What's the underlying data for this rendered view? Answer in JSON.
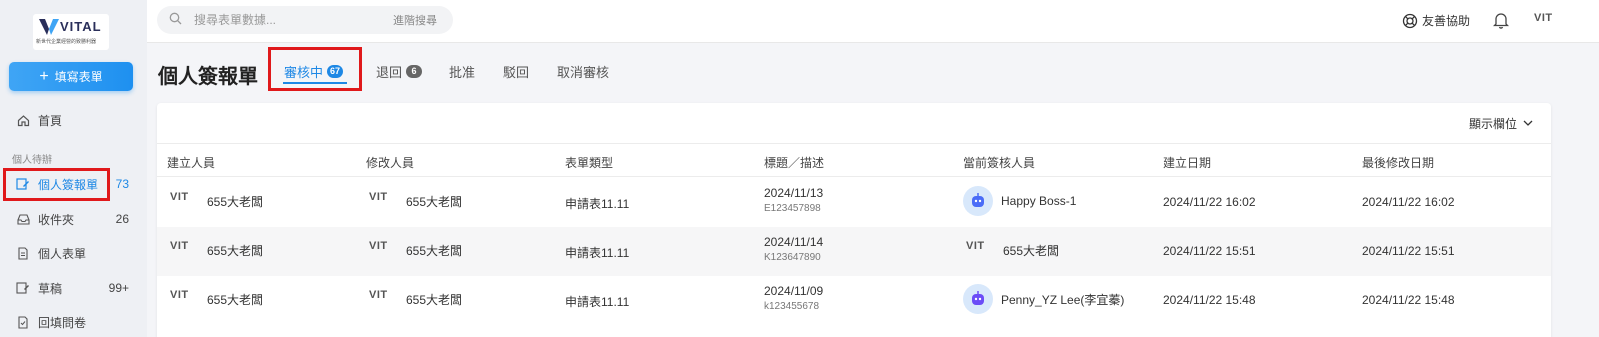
{
  "brand": {
    "name": "VITAL",
    "tagline": "新世代企業經營的致勝利器"
  },
  "sidebar": {
    "fill_button": "填寫表單",
    "home": "首頁",
    "section": "個人待辦",
    "items": [
      {
        "label": "個人簽報單",
        "count": "73",
        "icon": "edit-icon"
      },
      {
        "label": "收件夾",
        "count": "26",
        "icon": "inbox-icon"
      },
      {
        "label": "個人表單",
        "count": "",
        "icon": "document-icon"
      },
      {
        "label": "草稿",
        "count": "99+",
        "icon": "draft-icon"
      },
      {
        "label": "回填問卷",
        "count": "",
        "icon": "survey-icon"
      }
    ]
  },
  "topbar": {
    "search_placeholder": "搜尋表單數據...",
    "advanced_search": "進階搜尋",
    "help": "友善協助"
  },
  "page": {
    "title": "個人簽報單",
    "tabs": [
      {
        "label": "審核中",
        "badge": "67",
        "active": true
      },
      {
        "label": "退回",
        "badge": "6"
      },
      {
        "label": "批准"
      },
      {
        "label": "駁回"
      },
      {
        "label": "取消審核"
      }
    ]
  },
  "table": {
    "show_columns": "顯示欄位",
    "headers": [
      "建立人員",
      "修改人員",
      "表單類型",
      "標題／描述",
      "當前簽核人員",
      "建立日期",
      "最後修改日期"
    ],
    "rows": [
      {
        "creator": "655大老闆",
        "modifier": "655大老闆",
        "form_type": "申請表11.11",
        "title": "2024/11/13",
        "desc": "E123457898",
        "approver": "Happy Boss-1",
        "approver_avatar": "robot",
        "created": "2024/11/22 16:02",
        "modified": "2024/11/22 16:02"
      },
      {
        "creator": "655大老闆",
        "modifier": "655大老闆",
        "form_type": "申請表11.11",
        "title": "2024/11/14",
        "desc": "K123647890",
        "approver": "655大老闆",
        "approver_avatar": "logo",
        "created": "2024/11/22 15:51",
        "modified": "2024/11/22 15:51"
      },
      {
        "creator": "655大老闆",
        "modifier": "655大老闆",
        "form_type": "申請表11.11",
        "title": "2024/11/09",
        "desc": "k123455678",
        "approver": "Penny_YZ Lee(李宜蓁)",
        "approver_avatar": "robot",
        "created": "2024/11/22 15:48",
        "modified": "2024/11/22 15:48"
      }
    ]
  },
  "mini_logo_text": "VIT",
  "colors": {
    "accent": "#1e88e5",
    "highlight": "#e0191b"
  }
}
